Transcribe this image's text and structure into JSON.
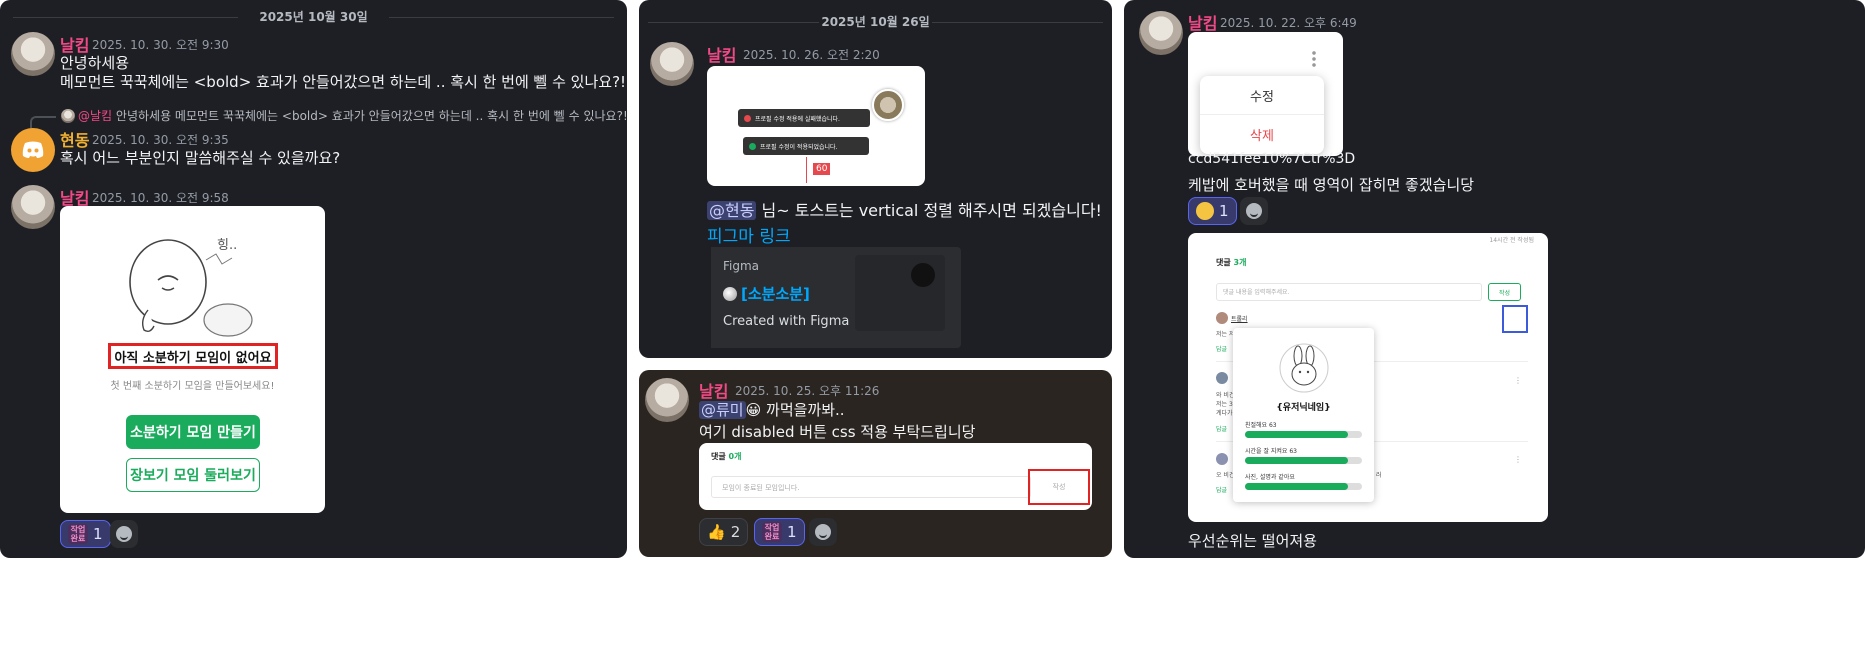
{
  "panel1": {
    "date": "2025년 10월 30일",
    "msg1": {
      "author": "날킴",
      "time": "2025. 10. 30. 오전 9:30",
      "line1": "안녕하세용",
      "line2": " 메모먼트 꾹꾹체에는 <bold> 효과가 안들어갔으면 하는데 .. 혹시 한 번에 뻴 수 있나요?!"
    },
    "reply": {
      "mention": "@날킴",
      "text": " 안녕하세용  메모먼트 꾹꾹체에는 <bold> 효과가 안들어갔으면 하는데 .. 혹시 한 번에 뻴 수 있나요?!"
    },
    "msg2": {
      "author": "현동",
      "time": "2025. 10. 30. 오전 9:35",
      "text": "혹시 어느 부분인지 말씀해주실 수 있을까요?"
    },
    "msg3": {
      "author": "날킴",
      "time": "2025. 10. 30. 오전 9:58"
    },
    "card": {
      "scribble": "힝..",
      "empty_title": "아직 소분하기 모임이 없어요",
      "empty_sub": "첫 번째 소분하기 모임을 만들어보세요!",
      "primary_btn": "소분하기 모임 만들기",
      "secondary_btn": "장보기 모임 둘러보기"
    },
    "reaction": {
      "badge_line1": "작업",
      "badge_line2": "완료",
      "count": "1"
    }
  },
  "panel2": {
    "date": "2025년 10월 26일",
    "msg1": {
      "author": "날킴",
      "time": "2025. 10. 26. 오전 2:20",
      "toast_error": "프로필 수정 적용에 실패했습니다.",
      "toast_ok": "프로필 수정이 적용되었습니다.",
      "measure": "60",
      "mention": "@현동",
      "text": " 님~ 토스트는 vertical 정렬 해주시면 되겠습니다!",
      "link": "피그마 링크"
    },
    "embed": {
      "provider": "Figma",
      "title": "[소분소분]",
      "desc": "Created with Figma"
    }
  },
  "panel3": {
    "msg1": {
      "author": "날킴",
      "time": "2025. 10. 25. 오후 11:26",
      "mention": "@류미",
      "emoji": "😀",
      "text1": " 까먹을까봐..",
      "text2": "여기 disabled 버튼 css 적용 부탁드립니당"
    },
    "card": {
      "comments_label": "댓글",
      "comments_count": "0개",
      "placeholder": "모임이 종료된 모임입니다.",
      "submit": "작성"
    },
    "reactions": [
      {
        "emoji": "👍",
        "count": "2"
      },
      {
        "badge_line1": "작업",
        "badge_line2": "완료",
        "count": "1"
      }
    ]
  },
  "panel4": {
    "msg1": {
      "author": "날킴",
      "time": "2025. 10. 22. 오후 6:49",
      "menu_edit": "수정",
      "menu_delete": "삭제",
      "url_tail": "ccd541fee10%7Ctr%3D",
      "text": "케밥에 호버했을 때 영역이 잡히면 좋겠습니당"
    },
    "reaction": {
      "count": "1"
    },
    "card": {
      "corner": "14시간 전 작성됨",
      "comments_label": "댓글",
      "comments_count": "3개",
      "placeholder": "댓글 내용을 입력해주세요.",
      "submit": "작성",
      "commenter": "트롤리",
      "c1": "저는 저",
      "reply": "답글",
      "c2a": "와 비건",
      "c2b": "저는 3",
      "c2c": "계다가",
      "c3": "오 비건",
      "c3tail": "러",
      "popup_name": "{유저닉네임}",
      "stats": [
        {
          "label": "친절해요 63",
          "pct": 0.88
        },
        {
          "label": "시간을 잘 지켜요 63",
          "pct": 0.88
        },
        {
          "label": "사진, 설명과 같아요",
          "pct": 0.88
        }
      ]
    },
    "footer": "우선순위는 떨어져용"
  }
}
